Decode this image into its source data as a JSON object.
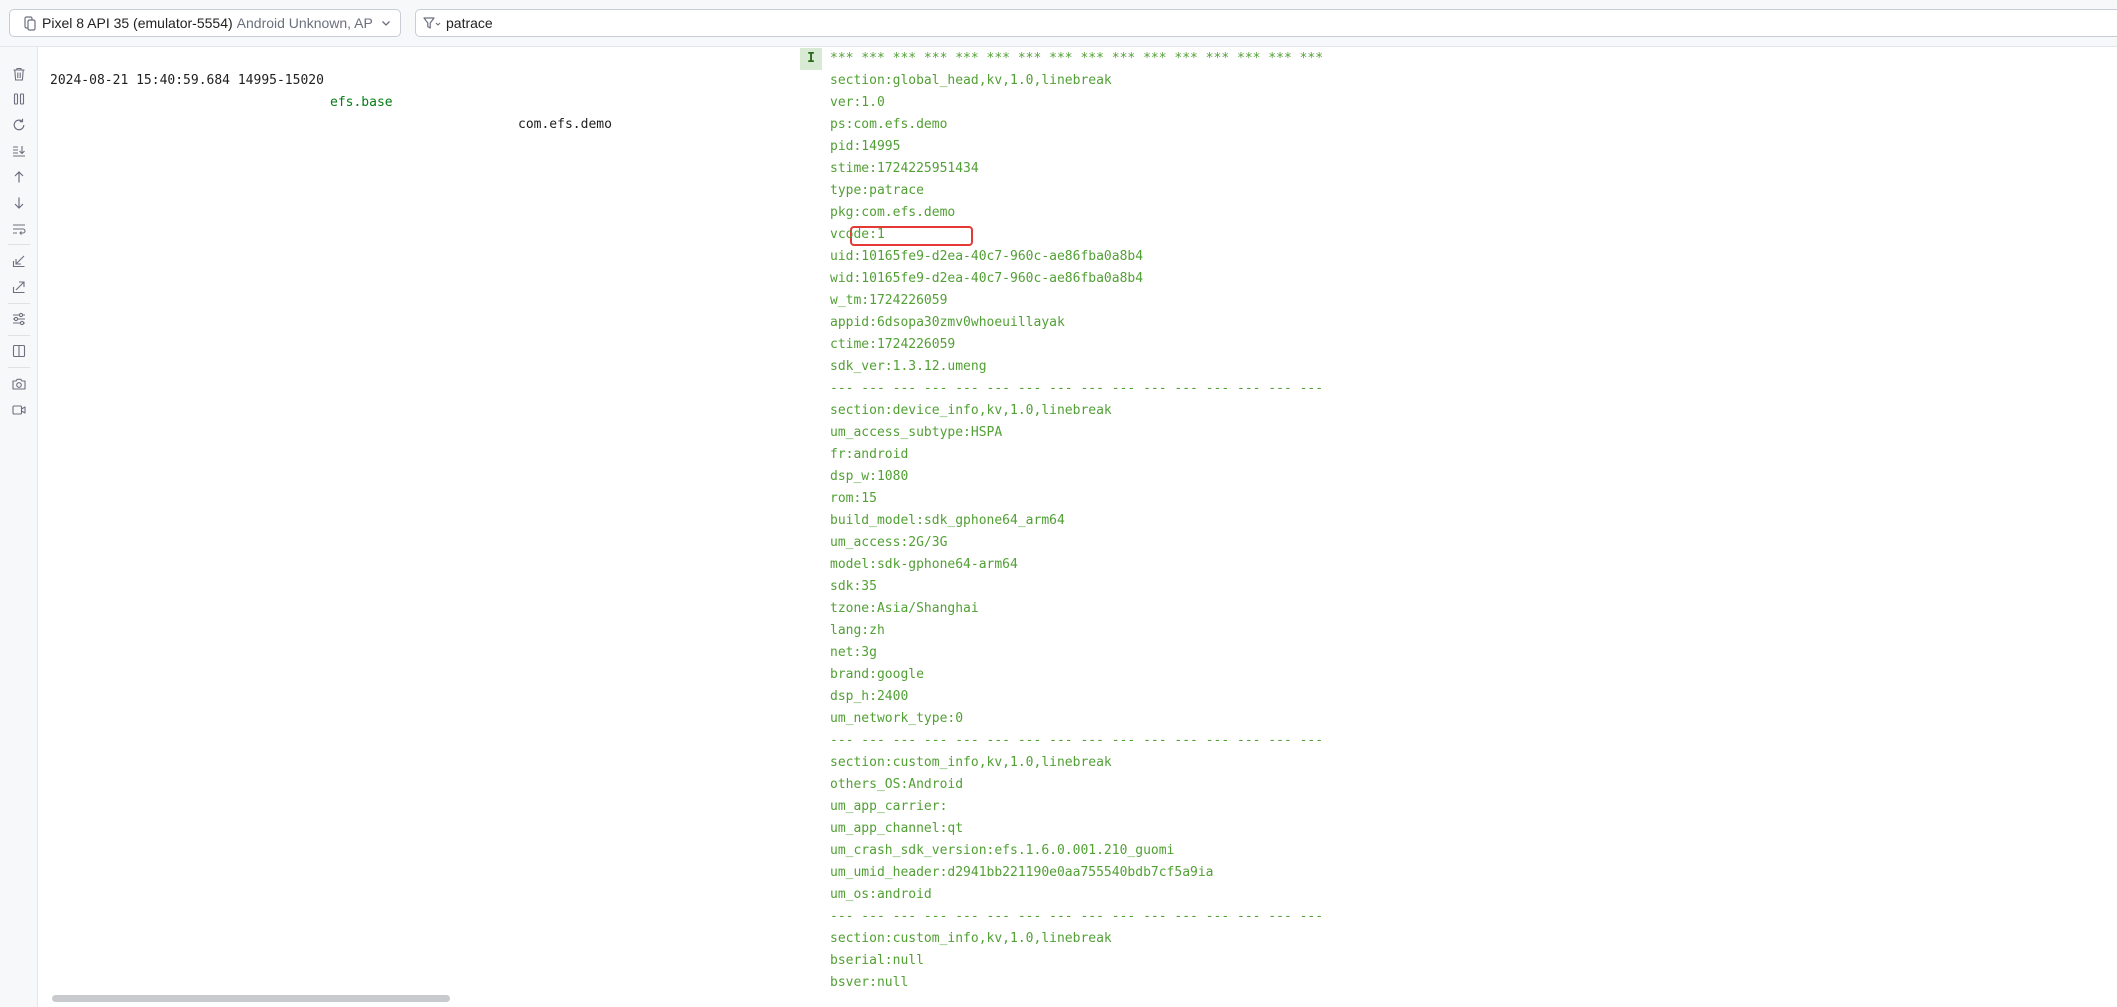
{
  "device_selector": {
    "name": "Pixel 8 API 35 (emulator-5554)",
    "subtitle": "Android Unknown, API"
  },
  "filter": {
    "query": "patrace"
  },
  "toolbar_icons": [
    "trash-icon",
    "pause-icon",
    "restart-icon",
    "scroll-to-end-icon",
    "arrow-up-icon",
    "arrow-down-icon",
    "soft-wrap-icon",
    "import-icon",
    "export-icon",
    "settings-sliders-icon",
    "split-panels-icon",
    "camera-icon",
    "video-icon"
  ],
  "log_entry": {
    "timestamp": "2024-08-21 15:40:59.684 14995-15020",
    "tag": "efs.base",
    "package": "com.efs.demo",
    "level": "I"
  },
  "log_lines": [
    "*** *** *** *** *** *** *** *** *** *** *** *** *** *** *** ***",
    "section:global_head,kv,1.0,linebreak",
    "ver:1.0",
    "ps:com.efs.demo",
    "pid:14995",
    "stime:1724225951434",
    "type:patrace",
    "pkg:com.efs.demo",
    "vcode:1",
    "uid:10165fe9-d2ea-40c7-960c-ae86fba0a8b4",
    "wid:10165fe9-d2ea-40c7-960c-ae86fba0a8b4",
    "w_tm:1724226059",
    "appid:6dsopa30zmv0whoeuillayak",
    "ctime:1724226059",
    "sdk_ver:1.3.12.umeng",
    "--- --- --- --- --- --- --- --- --- --- --- --- --- --- --- ---",
    "section:device_info,kv,1.0,linebreak",
    "um_access_subtype:HSPA",
    "fr:android",
    "dsp_w:1080",
    "rom:15",
    "build_model:sdk_gphone64_arm64",
    "um_access:2G/3G",
    "model:sdk-gphone64-arm64",
    "sdk:35",
    "tzone:Asia/Shanghai",
    "lang:zh",
    "net:3g",
    "brand:google",
    "dsp_h:2400",
    "um_network_type:0",
    "--- --- --- --- --- --- --- --- --- --- --- --- --- --- --- ---",
    "section:custom_info,kv,1.0,linebreak",
    "others_OS:Android",
    "um_app_carrier:",
    "um_app_channel:qt",
    "um_crash_sdk_version:efs.1.6.0.001.210_guomi",
    "um_umid_header:d2941bb221190e0aa755540bdb7cf5a9ia",
    "um_os:android",
    "--- --- --- --- --- --- --- --- --- --- --- --- --- --- --- ---",
    "section:custom_info,kv,1.0,linebreak",
    "bserial:null",
    "bsver:null"
  ],
  "highlighted_line": "type:patrace",
  "colors": {
    "highlight_border": "#e53935",
    "tag_green": "#067d17",
    "message_green": "#52a035",
    "level_badge_bg": "#d8ead3"
  }
}
